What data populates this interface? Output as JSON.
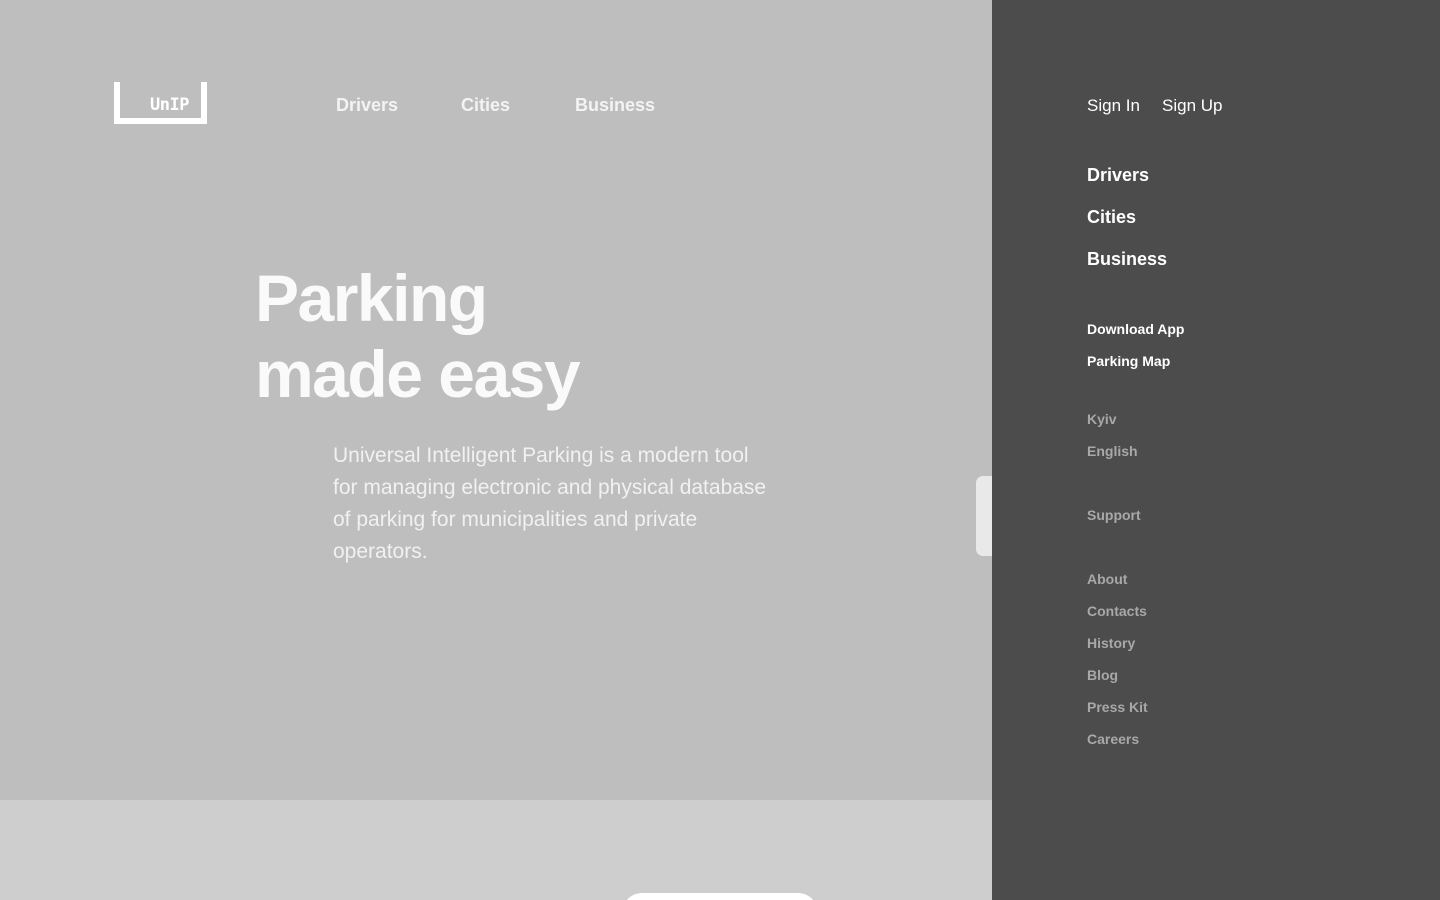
{
  "header": {
    "logo_text": "UnIP",
    "nav": [
      {
        "label": "Drivers"
      },
      {
        "label": "Cities"
      },
      {
        "label": "Business"
      }
    ]
  },
  "hero": {
    "headline_line1": "Parking",
    "headline_line2": "made easy",
    "description": "Universal Intelligent Parking is a modern tool for managing electronic and physical database of parking for municipalities and private operators."
  },
  "drawer": {
    "sign_in": "Sign In",
    "sign_up": "Sign Up",
    "primary_links": [
      "Drivers",
      "Cities",
      "Business"
    ],
    "app_links": [
      "Download App",
      "Parking Map"
    ],
    "city": "Kyiv",
    "language": "English",
    "support": "Support",
    "company_links": [
      "About",
      "Contacts",
      "History",
      "Blog",
      "Press Kit",
      "Careers"
    ]
  },
  "colors": {
    "page_background": "#bebebe",
    "lower_section": "#cecece",
    "drawer_background": "#4c4c4c",
    "text_primary": "#ffffff",
    "text_muted": "#a8a8a8"
  },
  "icons": {
    "logo": "bracket-logo-icon"
  }
}
